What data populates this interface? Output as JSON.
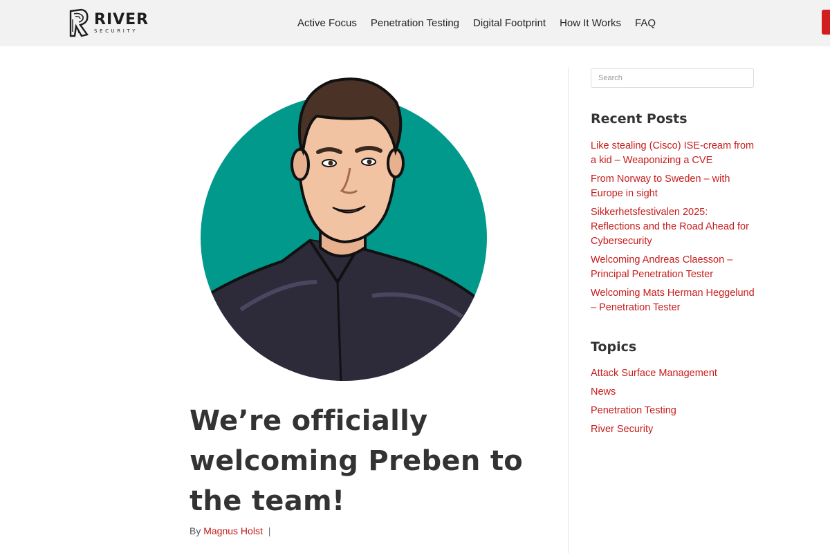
{
  "header": {
    "logo": {
      "word": "RIVER",
      "sub": "SECURITY"
    },
    "nav": [
      {
        "label": "Active Focus"
      },
      {
        "label": "Penetration Testing"
      },
      {
        "label": "Digital Footprint"
      },
      {
        "label": "How It Works"
      },
      {
        "label": "FAQ"
      }
    ]
  },
  "post": {
    "title": "We’re officially welcoming Preben to the team!",
    "meta": {
      "by_label": "By",
      "author": "Magnus Holst",
      "separator": "|"
    },
    "image": {
      "circle_color": "#00998c"
    }
  },
  "sidebar": {
    "search": {
      "placeholder": "Search",
      "value": ""
    },
    "recent_posts": {
      "title": "Recent Posts",
      "items": [
        {
          "label": "Like stealing (Cisco) ISE-cream from a kid – Weaponizing a CVE"
        },
        {
          "label": "From Norway to Sweden – with Europe in sight"
        },
        {
          "label": "Sikkerhetsfestivalen 2025: Reflections and the Road Ahead for Cybersecurity"
        },
        {
          "label": "Welcoming Andreas Claesson – Principal Penetration Tester"
        },
        {
          "label": "Welcoming Mats Herman Heggelund – Penetration Tester"
        }
      ]
    },
    "topics": {
      "title": "Topics",
      "items": [
        {
          "label": "Attack Surface Management"
        },
        {
          "label": "News"
        },
        {
          "label": "Penetration Testing"
        },
        {
          "label": "River Security"
        }
      ]
    }
  },
  "colors": {
    "accent": "#c81c1c",
    "header_bg": "#f2f2f2",
    "title": "#333333",
    "cta": "#d11f1f"
  }
}
